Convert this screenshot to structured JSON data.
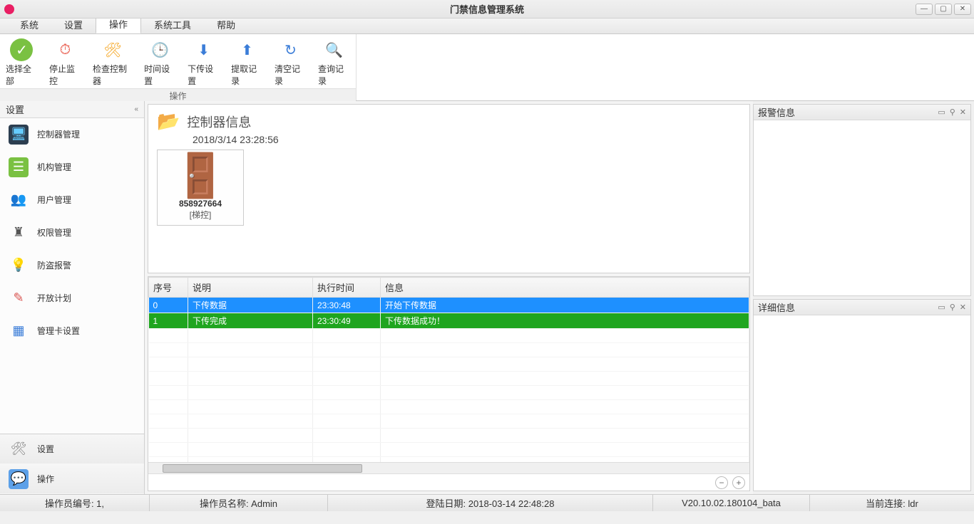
{
  "window": {
    "title": "门禁信息管理系统"
  },
  "menutabs": [
    {
      "label": "系统"
    },
    {
      "label": "设置"
    },
    {
      "label": "操作",
      "active": true
    },
    {
      "label": "系统工具"
    },
    {
      "label": "帮助"
    }
  ],
  "ribbon": {
    "group_label": "操作",
    "items": [
      {
        "label": "选择全部",
        "icon": "✓",
        "cls": "ic-green"
      },
      {
        "label": "停止监控",
        "icon": "⏱",
        "cls": "ic-red"
      },
      {
        "label": "检查控制器",
        "icon": "🛠",
        "cls": "ic-yellow"
      },
      {
        "label": "时间设置",
        "icon": "🕒",
        "cls": "ic-blue"
      },
      {
        "label": "下传设置",
        "icon": "⬇",
        "cls": "ic-blue"
      },
      {
        "label": "提取记录",
        "icon": "⬆",
        "cls": "ic-blue"
      },
      {
        "label": "清空记录",
        "icon": "↻",
        "cls": "ic-blue"
      },
      {
        "label": "查询记录",
        "icon": "🔍",
        "cls": "ic-purple"
      }
    ]
  },
  "sidebar": {
    "header": "设置",
    "items": [
      {
        "label": "控制器管理",
        "icon": "🖥",
        "cls": "ic-monitor"
      },
      {
        "label": "机构管理",
        "icon": "☰",
        "cls": "ic-org"
      },
      {
        "label": "用户管理",
        "icon": "👥",
        "cls": "ic-user"
      },
      {
        "label": "权限管理",
        "icon": "♜",
        "cls": "ic-perm"
      },
      {
        "label": "防盗报警",
        "icon": "💡",
        "cls": "ic-alarm"
      },
      {
        "label": "开放计划",
        "icon": "✎",
        "cls": "ic-plan"
      },
      {
        "label": "管理卡设置",
        "icon": "▦",
        "cls": "ic-card"
      }
    ],
    "bottom": [
      {
        "label": "设置",
        "icon": "🛠",
        "cls": "ic-gear"
      },
      {
        "label": "操作",
        "icon": "💬",
        "cls": "ic-chat"
      }
    ]
  },
  "view": {
    "title": "控制器信息",
    "timestamp": "2018/3/14 23:28:56",
    "device": {
      "id": "858927664",
      "type": "[梯控]"
    }
  },
  "grid": {
    "cols": {
      "seq": "序号",
      "desc": "说明",
      "time": "执行时间",
      "info": "信息"
    },
    "rows": [
      {
        "seq": "0",
        "desc": "下传数据",
        "time": "23:30:48",
        "info": "开始下传数据",
        "style": "row-blue"
      },
      {
        "seq": "1",
        "desc": "下传完成",
        "time": "23:30:49",
        "info": "下传数据成功！",
        "style": "row-green"
      }
    ]
  },
  "panels": {
    "alarm": "报警信息",
    "detail": "详细信息"
  },
  "status": {
    "operator_no": "操作员编号: 1,",
    "operator_name": "操作员名称: Admin",
    "login_date": "登陆日期: 2018-03-14 22:48:28",
    "version": "V20.10.02.180104_bata",
    "connection": "当前连接: ldr"
  }
}
